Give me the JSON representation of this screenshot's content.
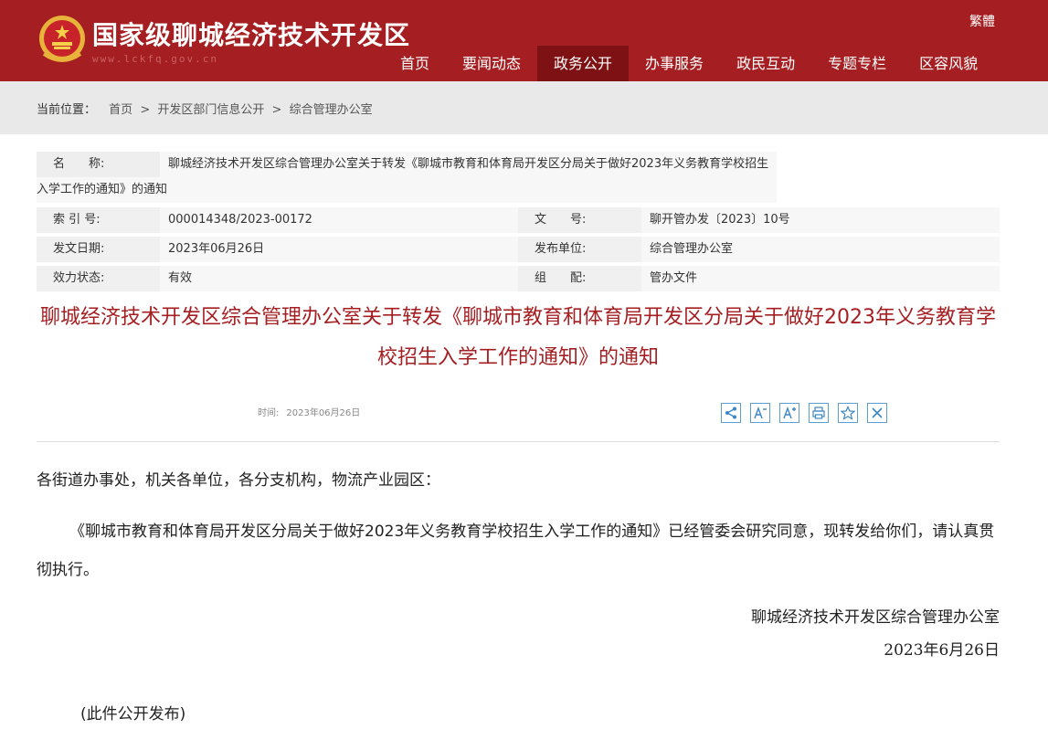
{
  "header": {
    "site_title": "国家级聊城经济技术开发区",
    "site_url": "www.lckfq.gov.cn",
    "lang_toggle": "繁體",
    "nav": [
      {
        "label": "首页",
        "active": false
      },
      {
        "label": "要闻动态",
        "active": false
      },
      {
        "label": "政务公开",
        "active": true
      },
      {
        "label": "办事服务",
        "active": false
      },
      {
        "label": "政民互动",
        "active": false
      },
      {
        "label": "专题专栏",
        "active": false
      },
      {
        "label": "区容风貌",
        "active": false
      }
    ],
    "colors": {
      "brand": "#a51f22",
      "nav_active": "#7e1113"
    }
  },
  "breadcrumb": {
    "label": "当前位置：",
    "items": [
      "首页",
      "开发区部门信息公开",
      "综合管理办公室"
    ],
    "separator": ">"
  },
  "meta": {
    "name_label": "名　　称:",
    "name_value": "聊城经济技术开发区综合管理办公室关于转发《聊城市教育和体育局开发区分局关于做好2023年义务教育学校招生入学工作的通知》的通知",
    "index_label": "索 引 号:",
    "index_value": "000014348/2023-00172",
    "doc_no_label": "文　　号:",
    "doc_no_value": "聊开管办发〔2023〕10号",
    "date_label": "发文日期:",
    "date_value": "2023年06月26日",
    "publisher_label": "发布单位:",
    "publisher_value": "综合管理办公室",
    "status_label": "效力状态:",
    "status_value": "有效",
    "category_label": "组　　配:",
    "category_value": "管办文件"
  },
  "article": {
    "title": "聊城经济技术开发区综合管理办公室关于转发《聊城市教育和体育局开发区分局关于做好2023年义务教育学校招生入学工作的通知》的通知",
    "time_label": "时间:",
    "time_value": "2023年06月26日",
    "tools": [
      "share-icon",
      "font-decrease-icon",
      "font-increase-icon",
      "print-icon",
      "favorite-icon",
      "close-icon"
    ],
    "greeting": "各街道办事处，机关各单位，各分支机构，物流产业园区：",
    "paragraph": "《聊城市教育和体育局开发区分局关于做好2023年义务教育学校招生入学工作的通知》已经管委会研究同意，现转发给你们，请认真贯彻执行。",
    "sign_org": "聊城经济技术开发区综合管理办公室",
    "sign_date": "2023年6月26日",
    "note": "(此件公开发布)"
  }
}
